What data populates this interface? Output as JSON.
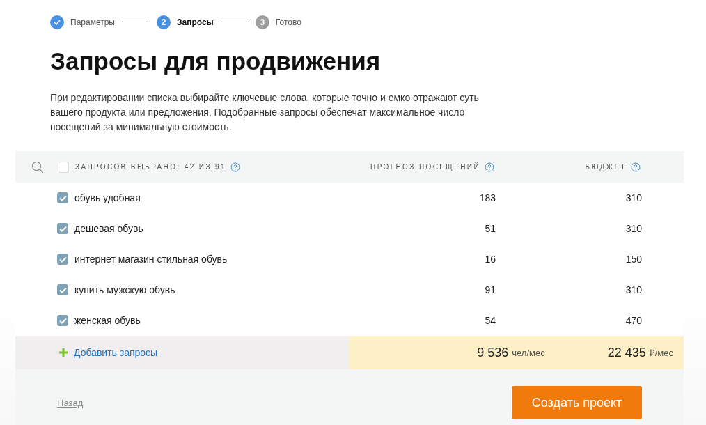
{
  "steps": [
    {
      "label": "Параметры",
      "completed": true,
      "selected": false
    },
    {
      "number": "2",
      "label": "Запросы",
      "completed": false,
      "selected": true
    },
    {
      "number": "3",
      "label": "Готово",
      "completed": false,
      "selected": false
    }
  ],
  "title": "Запросы для продвижения",
  "description": "При редактировании списка выбирайте ключевые слова, которые точно и емко отражают суть вашего продукта или предложения. Подобранные запросы обеспечат максимальное число посещений за минимальную стоимость.",
  "table": {
    "select_all_checked": false,
    "columns": [
      "ЗАПРОСОВ ВЫБРАНО: 42 ИЗ 91",
      "ПРОГНОЗ ПОСЕЩЕНИЙ",
      "БЮДЖЕТ"
    ],
    "rows": [
      {
        "query": "обувь удобная",
        "visits": "183",
        "budget": "310",
        "checked": true
      },
      {
        "query": "дешевая обувь",
        "visits": "51",
        "budget": "310",
        "checked": true
      },
      {
        "query": "интернет магазин стильная обувь",
        "visits": "16",
        "budget": "150",
        "checked": true
      },
      {
        "query": "купить мужскую обувь",
        "visits": "91",
        "budget": "310",
        "checked": true
      },
      {
        "query": "женская обувь",
        "visits": "54",
        "budget": "470",
        "checked": true
      }
    ],
    "add_link": "Добавить запросы",
    "total_visits": "9 536",
    "total_visits_unit": "чел/мес",
    "total_budget": "22 435",
    "total_budget_unit": "₽/мес"
  },
  "back_link": "Назад",
  "create_button": "Создать проект"
}
